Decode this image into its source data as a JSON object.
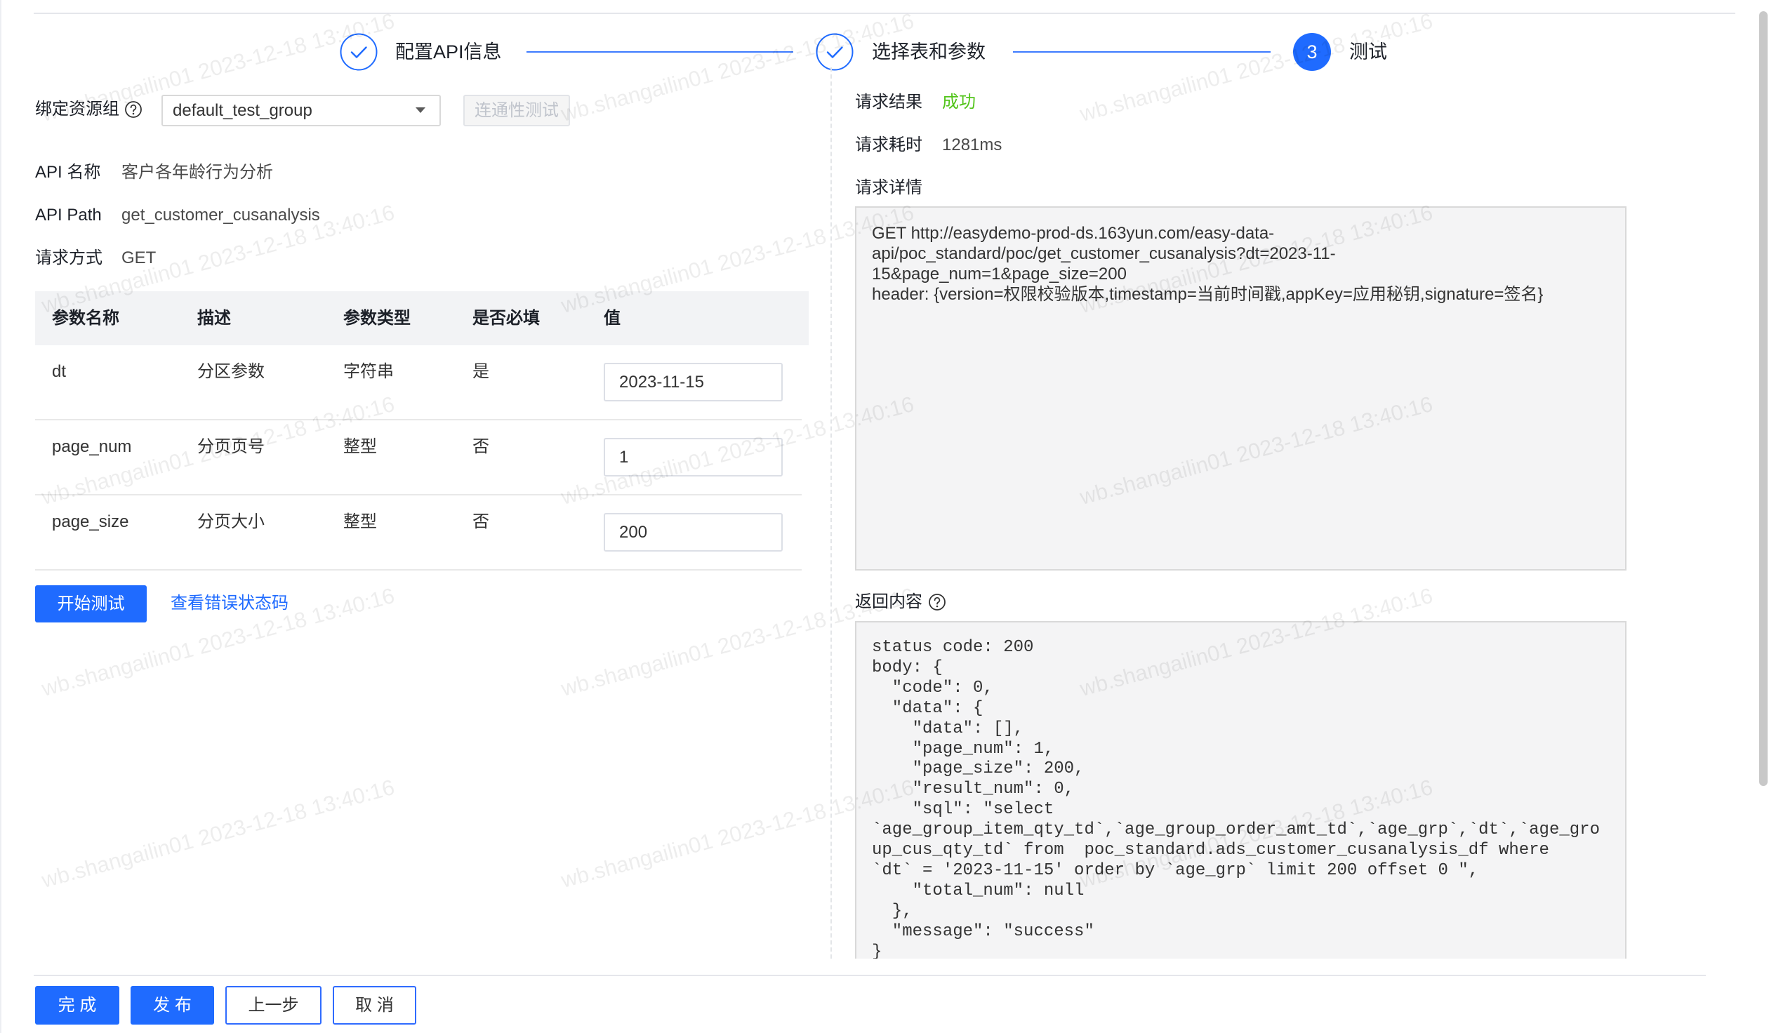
{
  "steps": [
    {
      "label": "配置API信息",
      "icon": "check-circle-icon"
    },
    {
      "label": "选择表和参数",
      "icon": "check-circle-icon"
    },
    {
      "label": "测试",
      "index": "3"
    }
  ],
  "form": {
    "resource_group": {
      "label": "绑定资源组",
      "help_icon": "question-circle-icon",
      "value": "default_test_group",
      "caret_icon": "caret-down-icon"
    },
    "connectivity_test": {
      "label": "连通性测试",
      "disabled": true
    },
    "api_name": {
      "label": "API 名称",
      "value": "客户各年龄行为分析"
    },
    "api_path": {
      "label": "API Path",
      "value": "get_customer_cusanalysis"
    },
    "method": {
      "label": "请求方式",
      "value": "GET"
    }
  },
  "params_table": {
    "columns": [
      "参数名称",
      "描述",
      "参数类型",
      "是否必填",
      "值"
    ],
    "rows": [
      {
        "name": "dt",
        "desc": "分区参数",
        "type": "字符串",
        "required": "是",
        "value": "2023-11-15"
      },
      {
        "name": "page_num",
        "desc": "分页页号",
        "type": "整型",
        "required": "否",
        "value": "1"
      },
      {
        "name": "page_size",
        "desc": "分页大小",
        "type": "整型",
        "required": "否",
        "value": "200"
      }
    ]
  },
  "test_actions": {
    "start_test": "开始测试",
    "view_error_codes": "查看错误状态码"
  },
  "result": {
    "status": {
      "label": "请求结果",
      "value": "成功"
    },
    "duration": {
      "label": "请求耗时",
      "value": "1281ms"
    },
    "detail": {
      "label": "请求详情",
      "lines": [
        "GET http://easydemo-prod-ds.163yun.com/easy-data-",
        "api/poc_standard/poc/get_customer_cusanalysis?dt=2023-11-",
        "15&page_num=1&page_size=200",
        "header: {version=权限校验版本,timestamp=当前时间戳,appKey=应用秘钥,signature=签名}"
      ]
    },
    "response": {
      "label": "返回内容",
      "help_icon": "question-circle-icon",
      "body": "status code: 200\nbody: {\n  \"code\": 0,\n  \"data\": {\n    \"data\": [],\n    \"page_num\": 1,\n    \"page_size\": 200,\n    \"result_num\": 0,\n    \"sql\": \"select\n`age_group_item_qty_td`,`age_group_order_amt_td`,`age_grp`,`dt`,`age_gro\nup_cus_qty_td` from  poc_standard.ads_customer_cusanalysis_df where\n`dt` = '2023-11-15' order by `age_grp` limit 200 offset 0 \",\n    \"total_num\": null\n  },\n  \"message\": \"success\"\n}"
    }
  },
  "footer": {
    "done": "完 成",
    "publish": "发 布",
    "previous": "上一步",
    "cancel": "取 消"
  },
  "watermark": "wb.shangailin01 2023-12-18 13:40:16",
  "colors": {
    "primary": "#1f6bff",
    "success": "#52c41a",
    "table_header_bg": "#f2f3f5"
  }
}
